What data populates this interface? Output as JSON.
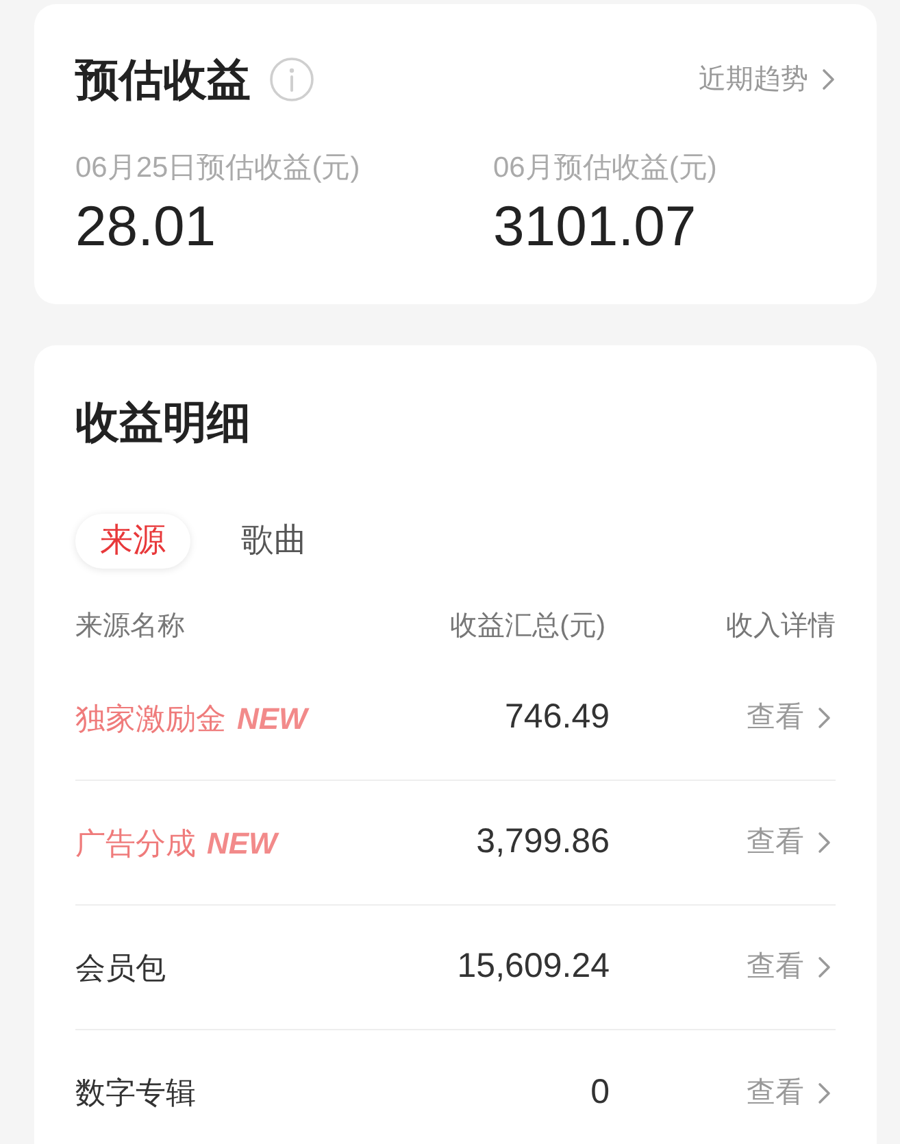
{
  "summary_card": {
    "title": "预估收益",
    "trend_link": "近期趋势",
    "stats": [
      {
        "label": "06月25日预估收益(元)",
        "value": "28.01"
      },
      {
        "label": "06月预估收益(元)",
        "value": "3101.07"
      }
    ]
  },
  "details_card": {
    "title": "收益明细",
    "tabs": [
      {
        "label": "来源",
        "selected": true
      },
      {
        "label": "歌曲",
        "selected": false
      }
    ],
    "table": {
      "columns": [
        "来源名称",
        "收益汇总(元)",
        "收入详情"
      ],
      "rows": [
        {
          "name": "独家激励金",
          "badge": "NEW",
          "total": "746.49",
          "action": "查看"
        },
        {
          "name": "广告分成",
          "badge": "NEW",
          "total": "3,799.86",
          "action": "查看"
        },
        {
          "name": "会员包",
          "total": "15,609.24",
          "action": "查看"
        },
        {
          "name": "数字专辑",
          "total": "0",
          "action": "查看"
        }
      ]
    }
  }
}
